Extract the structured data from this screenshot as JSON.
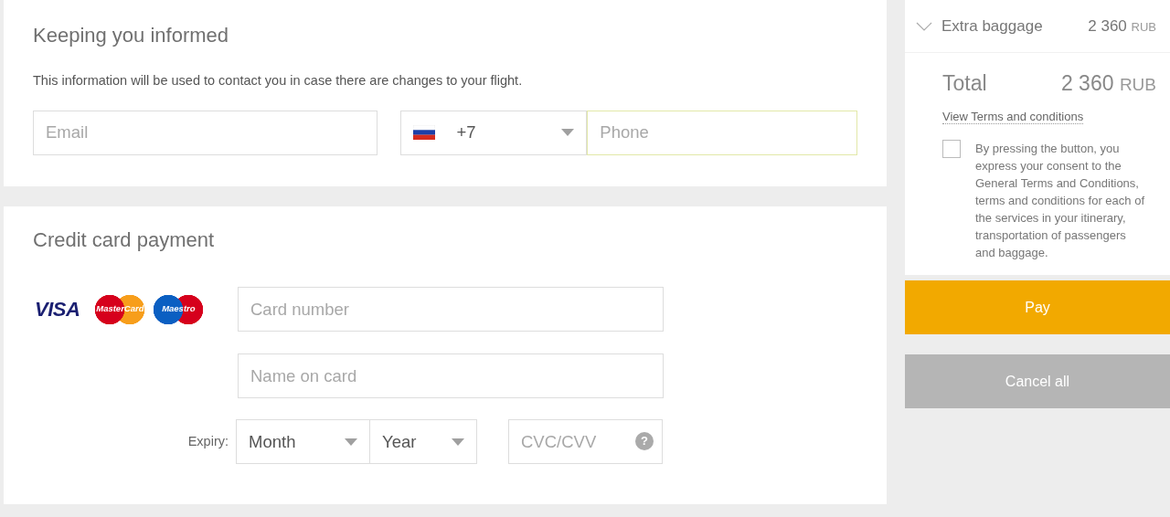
{
  "contact": {
    "title": "Keeping you informed",
    "note": "This information will be used to contact you in case there are changes to your flight.",
    "email": {
      "placeholder": "Email"
    },
    "country_code": {
      "value": "+7"
    },
    "phone": {
      "placeholder": "Phone",
      "focused": true
    }
  },
  "payment": {
    "title": "Credit card payment",
    "card_logos": [
      {
        "kind": "visa",
        "text": "VISA"
      },
      {
        "kind": "mastercard",
        "text": "MasterCard"
      },
      {
        "kind": "maestro",
        "text": "Maestro"
      }
    ],
    "card_number": {
      "placeholder": "Card number"
    },
    "name_on_card": {
      "placeholder": "Name on card"
    },
    "expiry_label": "Expiry:",
    "month": {
      "value": "Month"
    },
    "year": {
      "value": "Year"
    },
    "cvc": {
      "placeholder": "CVC/CVV",
      "help": "?"
    }
  },
  "summary": {
    "items": [
      {
        "label": "Extra baggage",
        "amount": "2 360",
        "currency": "RUB"
      }
    ],
    "total_label": "Total",
    "total_amount": "2 360",
    "total_currency": "RUB",
    "terms_link": "View Terms and conditions",
    "consent": {
      "checked": false,
      "text": "By pressing the button, you express your consent to the General Terms and Conditions, terms and conditions for each of the services in your itinerary, transportation of passengers and baggage."
    },
    "buttons": [
      {
        "label": "Pay",
        "kind": "primary"
      },
      {
        "label": "Cancel all",
        "kind": "secondary"
      }
    ]
  }
}
